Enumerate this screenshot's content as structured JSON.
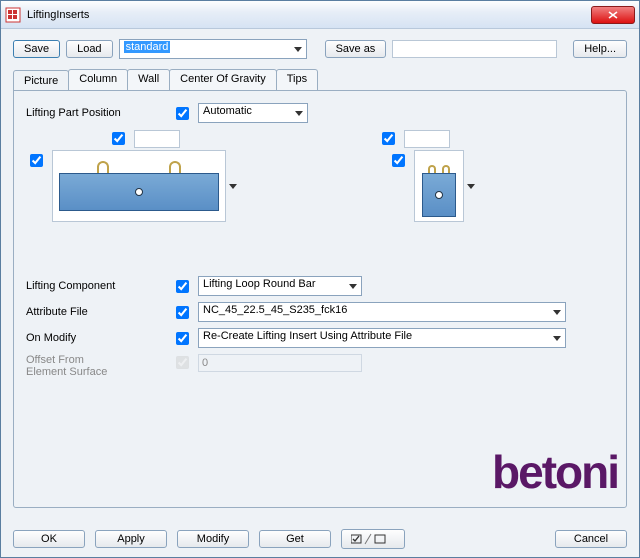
{
  "window": {
    "title": "LiftingInserts"
  },
  "toolbar": {
    "save": "Save",
    "load": "Load",
    "save_as": "Save as",
    "help": "Help...",
    "preset_value": "standard"
  },
  "tabs": [
    {
      "label": "Picture"
    },
    {
      "label": "Column"
    },
    {
      "label": "Wall"
    },
    {
      "label": "Center Of Gravity"
    },
    {
      "label": "Tips"
    }
  ],
  "picture": {
    "lifting_part_position_label": "Lifting Part Position",
    "lifting_part_position_value": "Automatic",
    "beam_offset_value": "",
    "col_offset_value": "",
    "lifting_component_label": "Lifting Component",
    "lifting_component_value": "Lifting Loop Round Bar",
    "attribute_file_label": "Attribute File",
    "attribute_file_value": "NC_45_22.5_45_S235_fck16",
    "on_modify_label": "On Modify",
    "on_modify_value": "Re-Create Lifting Insert Using Attribute File",
    "offset_label_line1": "Offset From",
    "offset_label_line2": "Element Surface",
    "offset_value": "0"
  },
  "logo_text": "betoni",
  "bottom": {
    "ok": "OK",
    "apply": "Apply",
    "modify": "Modify",
    "get": "Get",
    "cancel": "Cancel"
  }
}
